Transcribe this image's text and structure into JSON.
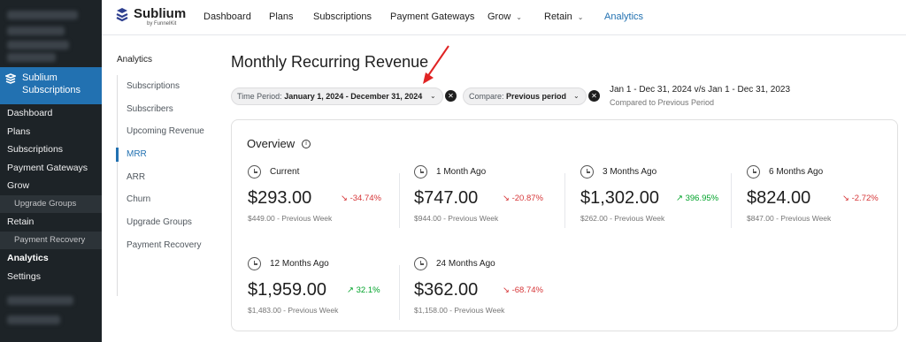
{
  "wp_sidebar": {
    "brand_label": "Sublium Subscriptions",
    "items": [
      {
        "label": "Dashboard",
        "sub": false,
        "active": false
      },
      {
        "label": "Plans",
        "sub": false,
        "active": false
      },
      {
        "label": "Subscriptions",
        "sub": false,
        "active": false
      },
      {
        "label": "Payment Gateways",
        "sub": false,
        "active": false
      },
      {
        "label": "Grow",
        "sub": false,
        "active": false
      },
      {
        "label": "Upgrade Groups",
        "sub": true,
        "active": false
      },
      {
        "label": "Retain",
        "sub": false,
        "active": false
      },
      {
        "label": "Payment Recovery",
        "sub": true,
        "active": false
      },
      {
        "label": "Analytics",
        "sub": false,
        "active": true
      },
      {
        "label": "Settings",
        "sub": false,
        "active": false
      }
    ]
  },
  "topbar": {
    "brand_name": "Sublium",
    "brand_by": "by FunnelKit",
    "nav": [
      {
        "label": "Dashboard"
      },
      {
        "label": "Plans"
      },
      {
        "label": "Subscriptions"
      },
      {
        "label": "Payment Gateways"
      },
      {
        "label": "Grow",
        "chevron": "chevron-down-icon"
      },
      {
        "label": "Retain",
        "chevron": "chevron-down-icon"
      },
      {
        "label": "Analytics",
        "active": true
      }
    ]
  },
  "analytics_nav": {
    "title": "Analytics",
    "items": [
      {
        "label": "Subscriptions"
      },
      {
        "label": "Subscribers"
      },
      {
        "label": "Upcoming Revenue"
      },
      {
        "label": "MRR",
        "active": true
      },
      {
        "label": "ARR"
      },
      {
        "label": "Churn"
      },
      {
        "label": "Upgrade Groups"
      },
      {
        "label": "Payment Recovery"
      }
    ]
  },
  "main": {
    "title": "Monthly Recurring Revenue",
    "filters": {
      "time_period_label": "Time Period:",
      "time_period_value": "January 1, 2024 - December 31, 2024",
      "compare_label": "Compare:",
      "compare_value": "Previous period"
    },
    "range_text": "Jan 1 - Dec 31, 2024 v/s Jan 1 - Dec 31, 2023",
    "range_sub": "Compared to Previous Period",
    "overview_title": "Overview",
    "metrics": [
      {
        "label": "Current",
        "value": "$293.00",
        "change": "-34.74%",
        "direction": "down",
        "previous": "$449.00 - Previous Week"
      },
      {
        "label": "1 Month Ago",
        "value": "$747.00",
        "change": "-20.87%",
        "direction": "down",
        "previous": "$944.00 - Previous Week"
      },
      {
        "label": "3 Months Ago",
        "value": "$1,302.00",
        "change": "396.95%",
        "direction": "up",
        "previous": "$262.00 - Previous Week"
      },
      {
        "label": "6 Months Ago",
        "value": "$824.00",
        "change": "-2.72%",
        "direction": "down",
        "previous": "$847.00 - Previous Week"
      },
      {
        "label": "12 Months Ago",
        "value": "$1,959.00",
        "change": "32.1%",
        "direction": "up",
        "previous": "$1,483.00 - Previous Week"
      },
      {
        "label": "24 Months Ago",
        "value": "$362.00",
        "change": "-68.74%",
        "direction": "down",
        "previous": "$1,158.00 - Previous Week"
      }
    ]
  },
  "colors": {
    "accent": "#2271b1",
    "down": "#d63638",
    "up": "#00a32a",
    "annotation_arrow": "#e02424"
  }
}
